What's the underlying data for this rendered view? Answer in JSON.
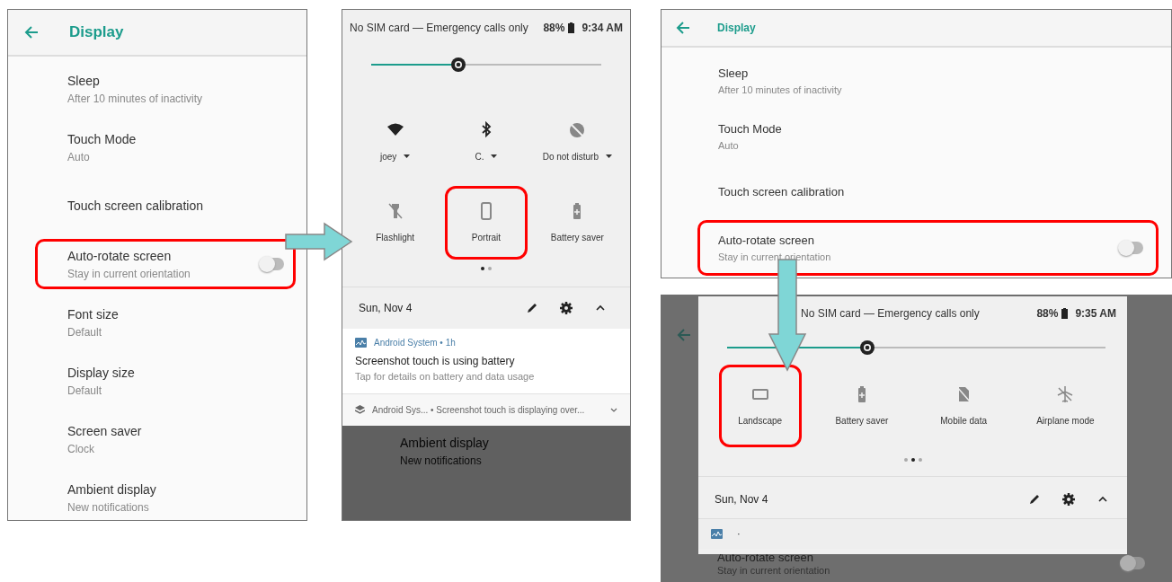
{
  "settings_portrait": {
    "title": "Display",
    "items": [
      {
        "title": "Sleep",
        "summary": "After 10 minutes of inactivity",
        "kind": "text",
        "highlighted": false
      },
      {
        "title": "Touch Mode",
        "summary": "Auto",
        "kind": "text",
        "highlighted": false
      },
      {
        "title": "Touch screen calibration",
        "kind": "text",
        "highlighted": false
      },
      {
        "title": "Auto-rotate screen",
        "summary": "Stay in current orientation",
        "kind": "toggle",
        "on": false,
        "highlighted": true
      },
      {
        "title": "Font size",
        "summary": "Default",
        "kind": "text",
        "highlighted": false
      },
      {
        "title": "Display size",
        "summary": "Default",
        "kind": "text",
        "highlighted": false
      },
      {
        "title": "Screen saver",
        "summary": "Clock",
        "kind": "text",
        "highlighted": false
      },
      {
        "title": "Ambient display",
        "summary": "New notifications",
        "kind": "text",
        "highlighted": false
      }
    ]
  },
  "quick_settings_portrait": {
    "status_text": "No SIM card — Emergency calls only",
    "battery": "88%",
    "time": "9:34 AM",
    "brightness": {
      "level": 0.38
    },
    "tiles": [
      {
        "label": "joey",
        "kind": "wifi",
        "on": true,
        "dropdown": true,
        "highlighted": false
      },
      {
        "label": "C.",
        "kind": "bluetooth",
        "on": true,
        "dropdown": true,
        "highlighted": false
      },
      {
        "label": "Do not disturb",
        "kind": "dnd",
        "on": false,
        "dropdown": true,
        "highlighted": false
      },
      {
        "label": "Flashlight",
        "kind": "flashlight",
        "on": false,
        "dropdown": false,
        "highlighted": false
      },
      {
        "label": "Portrait",
        "kind": "portrait",
        "on": false,
        "dropdown": false,
        "highlighted": true
      },
      {
        "label": "Battery saver",
        "kind": "battery",
        "on": false,
        "dropdown": false,
        "highlighted": false
      }
    ],
    "pages": [
      {
        "selected": true
      },
      {
        "selected": false
      }
    ],
    "date": "Sun, Nov 4",
    "notifications": [
      {
        "kind": "expanded",
        "header": "Android System • 1h",
        "title": "Screenshot touch is using battery",
        "text": "Tap for details on battery and data usage"
      },
      {
        "kind": "collapsed",
        "text": "Android Sys... • Screenshot touch is displaying over..."
      }
    ],
    "background_item": {
      "title": "Ambient display",
      "summary": "New notifications"
    }
  },
  "settings_landscape": {
    "title": "Display",
    "items": [
      {
        "title": "Sleep",
        "summary": "After 10 minutes of inactivity",
        "kind": "text",
        "highlighted": false
      },
      {
        "title": "Touch Mode",
        "summary": "Auto",
        "kind": "text",
        "highlighted": false
      },
      {
        "title": "Touch screen calibration",
        "kind": "text",
        "highlighted": false
      },
      {
        "title": "Auto-rotate screen",
        "summary": "Stay in current orientation",
        "kind": "toggle",
        "on": false,
        "highlighted": true
      }
    ]
  },
  "quick_settings_landscape": {
    "status_text": "No SIM card — Emergency calls only",
    "battery": "88%",
    "time": "9:35 AM",
    "brightness": {
      "level": 0.37
    },
    "tiles": [
      {
        "label": "Landscape",
        "kind": "landscape",
        "on": false,
        "dropdown": false,
        "highlighted": true
      },
      {
        "label": "Battery saver",
        "kind": "battery",
        "on": false,
        "dropdown": false,
        "highlighted": false
      },
      {
        "label": "Mobile data",
        "kind": "mobiledata",
        "on": false,
        "dropdown": false,
        "highlighted": false
      },
      {
        "label": "Airplane mode",
        "kind": "airplane",
        "on": false,
        "dropdown": false,
        "highlighted": false
      }
    ],
    "pages": [
      {
        "selected": false
      },
      {
        "selected": true
      },
      {
        "selected": false
      }
    ],
    "date": "Sun, Nov 4",
    "notifications": [
      {
        "kind": "partial",
        "text": "·"
      }
    ],
    "background_item": {
      "title": "Auto-rotate screen",
      "summary": "Stay in current orientation",
      "on": false
    }
  }
}
